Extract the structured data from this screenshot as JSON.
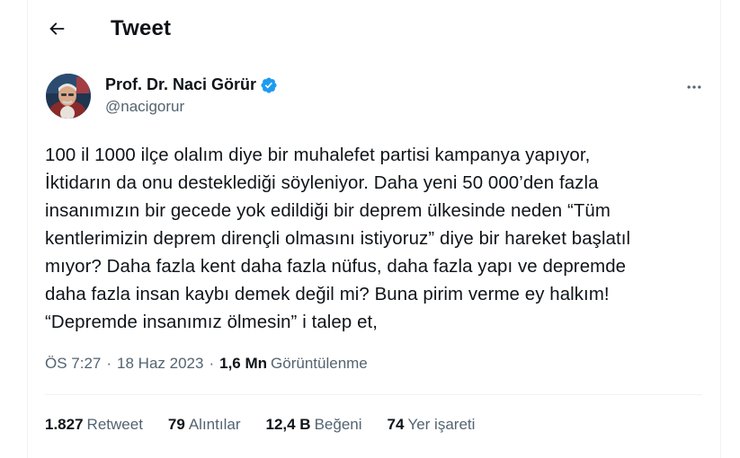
{
  "header": {
    "title": "Tweet",
    "back_icon": "arrow-left-icon"
  },
  "author": {
    "name": "Prof. Dr. Naci Görür",
    "handle": "@nacigorur",
    "verified": true,
    "verified_color": "#1d9bf0"
  },
  "tweet": {
    "lines": [
      "100 il 1000 ilçe olalım diye bir muhalefet partisi kampanya yapıyor,",
      "İktidarın da onu desteklediği söyleniyor. Daha yeni 50 000’den fazla",
      "insanımızın bir gecede yok edildiği bir deprem ülkesinde neden  “Tüm",
      "kentlerimizin deprem dirençli olmasını istiyoruz” diye bir hareket başlatıl",
      "mıyor? Daha fazla kent daha fazla nüfus, daha fazla yapı ve depremde",
      "daha fazla insan kaybı demek değil mi? Buna pirim verme ey halkım!",
      "“Depremde insanımız ölmesin” i talep et,"
    ],
    "time": "ÖS 7:27",
    "separator": "·",
    "date": "18 Haz 2023",
    "views_count": "1,6 Mn",
    "views_label": "Görüntülenme"
  },
  "stats": {
    "retweets_count": "1.827",
    "retweets_label": "Retweet",
    "quotes_count": "79",
    "quotes_label": "Alıntılar",
    "likes_count": "12,4 B",
    "likes_label": "Beğeni",
    "bookmarks_count": "74",
    "bookmarks_label": "Yer işareti"
  },
  "colors": {
    "text": "#0f1419",
    "secondary": "#536471",
    "border": "#eff3f4"
  }
}
